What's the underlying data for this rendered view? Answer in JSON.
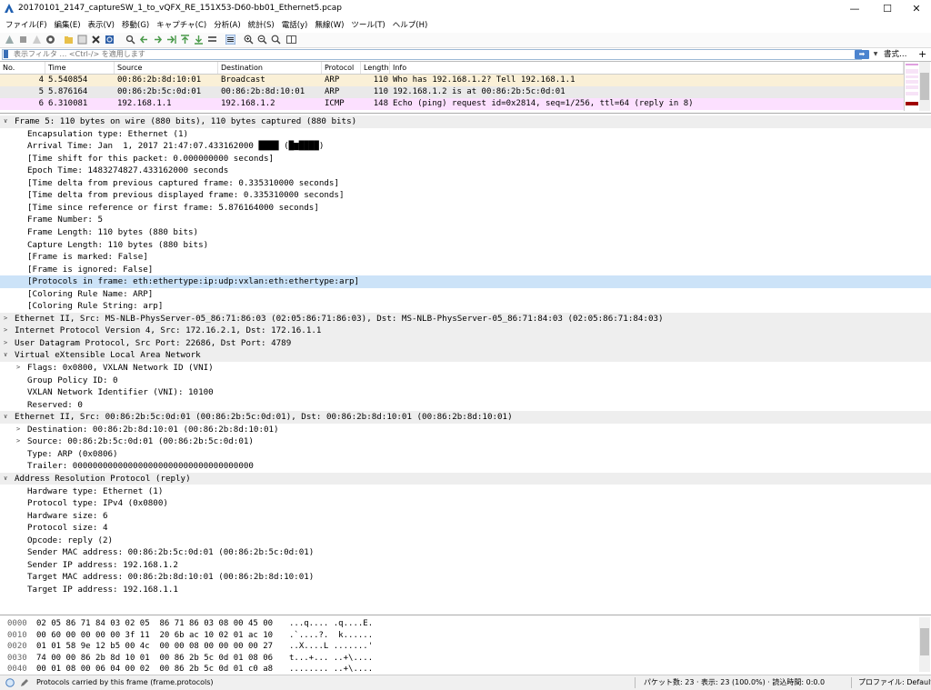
{
  "window": {
    "title": "20170101_2147_captureSW_1_to_vQFX_RE_151X53-D60-bb01_Ethernet5.pcap",
    "minimize": "—",
    "maximize": "☐",
    "close": "✕"
  },
  "menu": [
    "ファイル(F)",
    "編集(E)",
    "表示(V)",
    "移動(G)",
    "キャプチャ(C)",
    "分析(A)",
    "統計(S)",
    "電話(y)",
    "無線(W)",
    "ツール(T)",
    "ヘルプ(H)"
  ],
  "filter": {
    "placeholder": "表示フィルタ … <Ctrl-/> を適用します",
    "expression_label": "書式…",
    "plus_label": "+"
  },
  "packet_list": {
    "columns": [
      "No.",
      "Time",
      "Source",
      "Destination",
      "Protocol",
      "Length",
      "Info"
    ],
    "rows": [
      {
        "no": "4",
        "time": "5.540854",
        "source": "00:86:2b:8d:10:01",
        "destination": "Broadcast",
        "protocol": "ARP",
        "length": "110",
        "info": "Who has 192.168.1.2? Tell 192.168.1.1",
        "color": "#faf0d7"
      },
      {
        "no": "5",
        "time": "5.876164",
        "source": "00:86:2b:5c:0d:01",
        "destination": "00:86:2b:8d:10:01",
        "protocol": "ARP",
        "length": "110",
        "info": "192.168.1.2 is at 00:86:2b:5c:0d:01",
        "color": "#e9e9e9"
      },
      {
        "no": "6",
        "time": "6.310081",
        "source": "192.168.1.1",
        "destination": "192.168.1.2",
        "protocol": "ICMP",
        "length": "148",
        "info": "Echo (ping) request  id=0x2814, seq=1/256, ttl=64 (reply in 8)",
        "color": "#fce0ff"
      }
    ]
  },
  "details": [
    {
      "level": 0,
      "tri": "∨",
      "text": "Frame 5: 110 bytes on wire (880 bits), 110 bytes captured (880 bits)",
      "style": "hdr"
    },
    {
      "level": 1,
      "tri": "",
      "text": "Encapsulation type: Ethernet (1)",
      "style": ""
    },
    {
      "level": 1,
      "tri": "",
      "text": "Arrival Time: Jan  1, 2017 21:47:07.433162000 ████ (█▆████)",
      "style": ""
    },
    {
      "level": 1,
      "tri": "",
      "text": "[Time shift for this packet: 0.000000000 seconds]",
      "style": ""
    },
    {
      "level": 1,
      "tri": "",
      "text": "Epoch Time: 1483274827.433162000 seconds",
      "style": ""
    },
    {
      "level": 1,
      "tri": "",
      "text": "[Time delta from previous captured frame: 0.335310000 seconds]",
      "style": ""
    },
    {
      "level": 1,
      "tri": "",
      "text": "[Time delta from previous displayed frame: 0.335310000 seconds]",
      "style": ""
    },
    {
      "level": 1,
      "tri": "",
      "text": "[Time since reference or first frame: 5.876164000 seconds]",
      "style": ""
    },
    {
      "level": 1,
      "tri": "",
      "text": "Frame Number: 5",
      "style": ""
    },
    {
      "level": 1,
      "tri": "",
      "text": "Frame Length: 110 bytes (880 bits)",
      "style": ""
    },
    {
      "level": 1,
      "tri": "",
      "text": "Capture Length: 110 bytes (880 bits)",
      "style": ""
    },
    {
      "level": 1,
      "tri": "",
      "text": "[Frame is marked: False]",
      "style": ""
    },
    {
      "level": 1,
      "tri": "",
      "text": "[Frame is ignored: False]",
      "style": ""
    },
    {
      "level": 1,
      "tri": "",
      "text": "[Protocols in frame: eth:ethertype:ip:udp:vxlan:eth:ethertype:arp]",
      "style": "sel"
    },
    {
      "level": 1,
      "tri": "",
      "text": "[Coloring Rule Name: ARP]",
      "style": ""
    },
    {
      "level": 1,
      "tri": "",
      "text": "[Coloring Rule String: arp]",
      "style": ""
    },
    {
      "level": 0,
      "tri": ">",
      "text": "Ethernet II, Src: MS-NLB-PhysServer-05_86:71:86:03 (02:05:86:71:86:03), Dst: MS-NLB-PhysServer-05_86:71:84:03 (02:05:86:71:84:03)",
      "style": "hdr"
    },
    {
      "level": 0,
      "tri": ">",
      "text": "Internet Protocol Version 4, Src: 172.16.2.1, Dst: 172.16.1.1",
      "style": "hdr"
    },
    {
      "level": 0,
      "tri": ">",
      "text": "User Datagram Protocol, Src Port: 22686, Dst Port: 4789",
      "style": "hdr"
    },
    {
      "level": 0,
      "tri": "∨",
      "text": "Virtual eXtensible Local Area Network",
      "style": "hdr"
    },
    {
      "level": 1,
      "tri": ">",
      "text": "Flags: 0x0800, VXLAN Network ID (VNI)",
      "style": ""
    },
    {
      "level": 1,
      "tri": "",
      "text": "Group Policy ID: 0",
      "style": ""
    },
    {
      "level": 1,
      "tri": "",
      "text": "VXLAN Network Identifier (VNI): 10100",
      "style": ""
    },
    {
      "level": 1,
      "tri": "",
      "text": "Reserved: 0",
      "style": ""
    },
    {
      "level": 0,
      "tri": "∨",
      "text": "Ethernet II, Src: 00:86:2b:5c:0d:01 (00:86:2b:5c:0d:01), Dst: 00:86:2b:8d:10:01 (00:86:2b:8d:10:01)",
      "style": "hdr"
    },
    {
      "level": 1,
      "tri": ">",
      "text": "Destination: 00:86:2b:8d:10:01 (00:86:2b:8d:10:01)",
      "style": ""
    },
    {
      "level": 1,
      "tri": ">",
      "text": "Source: 00:86:2b:5c:0d:01 (00:86:2b:5c:0d:01)",
      "style": ""
    },
    {
      "level": 1,
      "tri": "",
      "text": "Type: ARP (0x0806)",
      "style": ""
    },
    {
      "level": 1,
      "tri": "",
      "text": "Trailer: 000000000000000000000000000000000000",
      "style": ""
    },
    {
      "level": 0,
      "tri": "∨",
      "text": "Address Resolution Protocol (reply)",
      "style": "hdr"
    },
    {
      "level": 1,
      "tri": "",
      "text": "Hardware type: Ethernet (1)",
      "style": ""
    },
    {
      "level": 1,
      "tri": "",
      "text": "Protocol type: IPv4 (0x0800)",
      "style": ""
    },
    {
      "level": 1,
      "tri": "",
      "text": "Hardware size: 6",
      "style": ""
    },
    {
      "level": 1,
      "tri": "",
      "text": "Protocol size: 4",
      "style": ""
    },
    {
      "level": 1,
      "tri": "",
      "text": "Opcode: reply (2)",
      "style": ""
    },
    {
      "level": 1,
      "tri": "",
      "text": "Sender MAC address: 00:86:2b:5c:0d:01 (00:86:2b:5c:0d:01)",
      "style": ""
    },
    {
      "level": 1,
      "tri": "",
      "text": "Sender IP address: 192.168.1.2",
      "style": ""
    },
    {
      "level": 1,
      "tri": "",
      "text": "Target MAC address: 00:86:2b:8d:10:01 (00:86:2b:8d:10:01)",
      "style": ""
    },
    {
      "level": 1,
      "tri": "",
      "text": "Target IP address: 192.168.1.1",
      "style": ""
    }
  ],
  "bytes": [
    {
      "offset": "0000",
      "hex": "02 05 86 71 84 03 02 05  86 71 86 03 08 00 45 00",
      "ascii": "...q.... .q....E."
    },
    {
      "offset": "0010",
      "hex": "00 60 00 00 00 00 3f 11  20 6b ac 10 02 01 ac 10",
      "ascii": ".`....?.  k......"
    },
    {
      "offset": "0020",
      "hex": "01 01 58 9e 12 b5 00 4c  00 00 08 00 00 00 00 27",
      "ascii": "..X....L .......'"
    },
    {
      "offset": "0030",
      "hex": "74 00 00 86 2b 8d 10 01  00 86 2b 5c 0d 01 08 06",
      "ascii": "t...+... ..+\\...."
    },
    {
      "offset": "0040",
      "hex": "00 01 08 00 06 04 00 02  00 86 2b 5c 0d 01 c0 a8",
      "ascii": "........ ..+\\...."
    }
  ],
  "status": {
    "message": "Protocols carried by this frame (frame.protocols)",
    "stats": "パケット数: 23 · 表示: 23 (100.0%) · 読込時間: 0:0.0",
    "profile": "プロファイル: Default"
  },
  "colors": {
    "selected_row": "#cce3f8",
    "header_row": "#eeeeee",
    "filter_apply": "#4c84cf",
    "app_icon": "#1f5fb0"
  }
}
